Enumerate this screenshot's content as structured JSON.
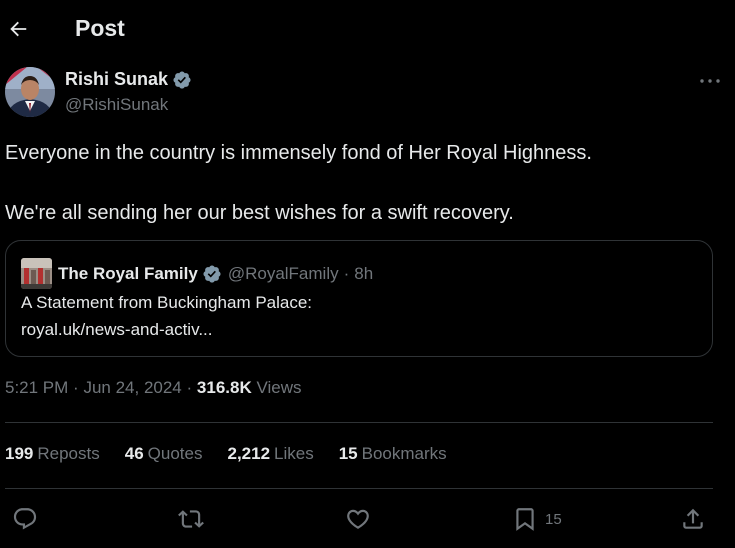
{
  "header": {
    "title": "Post"
  },
  "author": {
    "name": "Rishi Sunak",
    "handle": "@RishiSunak"
  },
  "tweet": {
    "paragraphs": [
      "Everyone in the country is immensely fond of Her Royal Highness.",
      "We're all sending her our best wishes for a swift recovery."
    ]
  },
  "quote": {
    "name": "The Royal Family",
    "handle": "@RoyalFamily",
    "separator": "·",
    "time": "8h",
    "line1": "A Statement from Buckingham Palace:",
    "line2": "royal.uk/news-and-activ..."
  },
  "meta": {
    "time": "5:21 PM",
    "separator": "·",
    "date": "Jun 24, 2024",
    "views_count": "316.8K",
    "views_label": "Views"
  },
  "stats": {
    "reposts_count": "199",
    "reposts_label": "Reposts",
    "quotes_count": "46",
    "quotes_label": "Quotes",
    "likes_count": "2,212",
    "likes_label": "Likes",
    "bookmarks_count": "15",
    "bookmarks_label": "Bookmarks"
  },
  "actions": {
    "bookmark_count": "15"
  },
  "icons": {
    "back": "arrow-left-icon",
    "verified": "verified-badge-icon",
    "more": "more-horizontal-icon",
    "reply": "reply-icon",
    "repost": "repost-icon",
    "like": "heart-icon",
    "bookmark": "bookmark-icon",
    "share": "share-icon"
  },
  "colors": {
    "background": "#000000",
    "text": "#e7e9ea",
    "muted": "#71767b",
    "verified": "#829aab",
    "border": "#2f3336"
  }
}
